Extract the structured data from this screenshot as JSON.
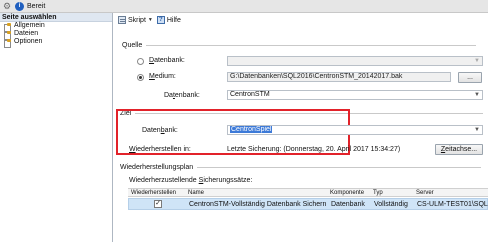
{
  "topbar": {
    "status": "Bereit"
  },
  "sidebar": {
    "header": "Seite auswählen",
    "items": [
      {
        "label": "Allgemein"
      },
      {
        "label": "Dateien"
      },
      {
        "label": "Optionen"
      }
    ]
  },
  "toolbar": {
    "script_label": "Skript",
    "help_label": "Hilfe"
  },
  "source": {
    "title": "Quelle",
    "database_option": {
      "prefix": "",
      "accel": "D",
      "rest": "atenbank:"
    },
    "database_value": "",
    "medium_option": {
      "prefix": "",
      "accel": "M",
      "rest": "edium:"
    },
    "medium_value": "G:\\Datenbanken\\SQL2016\\CentronSTM_20142017.bak",
    "medium_button": "...",
    "database_label": {
      "prefix": "Da",
      "accel": "t",
      "rest": "enbank:"
    },
    "database_select": "CentronSTM"
  },
  "target": {
    "title": "Ziel",
    "database_label": {
      "prefix": "Daten",
      "accel": "b",
      "rest": "ank:"
    },
    "database_value": "CentronSpiel",
    "restore_to_label": {
      "prefix": "",
      "accel": "W",
      "rest": "iederherstellen in:"
    },
    "restore_to_value": "Letzte Sicherung: (Donnerstag, 20. April 2017 15:34:27)",
    "timeline_button": {
      "prefix": "",
      "accel": "Z",
      "rest": "eitachse..."
    }
  },
  "plan": {
    "title": "Wiederherstellungsplan",
    "sets_label": {
      "prefix": "Wiederherzustellende ",
      "accel": "S",
      "rest": "icherungssätze:"
    },
    "columns": [
      "Wiederherstellen",
      "Name",
      "Komponente",
      "Typ",
      "Server"
    ],
    "rows": [
      {
        "restore": "✓",
        "name": "CentronSTM-Vollständig Datenbank Sichern",
        "component": "Datenbank",
        "type": "Vollständig",
        "server": "CS-ULM-TEST01\\SQL"
      }
    ]
  },
  "colors": {
    "accent": "#3d7ad8",
    "highlight_box": "#e2222a",
    "row_selected": "#cfe4f7"
  }
}
